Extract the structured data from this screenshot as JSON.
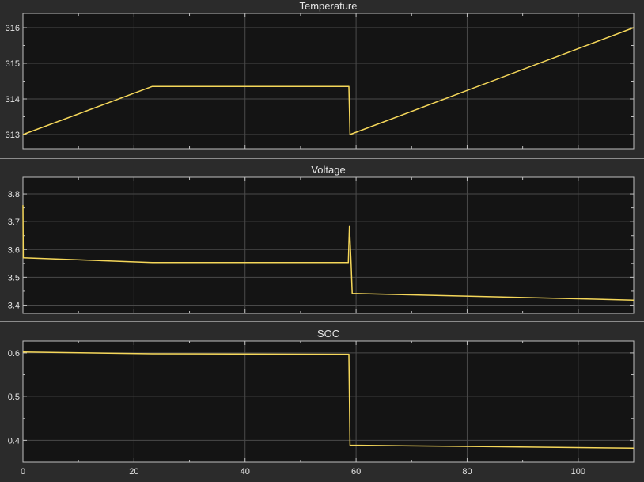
{
  "colors": {
    "background": "#2b2b2b",
    "plot_background": "#141414",
    "grid": "#4a4a4a",
    "axis": "#bfbfbf",
    "text": "#e6e6e6",
    "trace": "#f5d75a"
  },
  "chart_data": [
    {
      "type": "line",
      "title": "Temperature",
      "xlim": [
        0,
        110
      ],
      "ylim": [
        312.6,
        316.4
      ],
      "xticks": [
        0,
        20,
        40,
        60,
        80,
        100
      ],
      "yticks": [
        313,
        314,
        315,
        316
      ],
      "grid": true,
      "show_xtick_labels": false,
      "series": [
        {
          "x": [
            0,
            23.3,
            58.7,
            58.9,
            110
          ],
          "y": [
            313.0,
            314.35,
            314.35,
            313.0,
            316.0
          ]
        }
      ]
    },
    {
      "type": "line",
      "title": "Voltage",
      "xlim": [
        0,
        110
      ],
      "ylim": [
        3.37,
        3.86
      ],
      "xticks": [
        0,
        20,
        40,
        60,
        80,
        100
      ],
      "yticks": [
        3.4,
        3.5,
        3.6,
        3.7,
        3.8
      ],
      "grid": true,
      "show_xtick_labels": false,
      "series": [
        {
          "x": [
            0,
            0.05,
            23.3,
            58.6,
            58.8,
            59.1,
            59.3,
            110
          ],
          "y": [
            3.76,
            3.57,
            3.553,
            3.553,
            3.685,
            3.55,
            3.442,
            3.418
          ]
        }
      ]
    },
    {
      "type": "line",
      "title": "SOC",
      "xlim": [
        0,
        110
      ],
      "ylim": [
        0.35,
        0.627
      ],
      "xticks": [
        0,
        20,
        40,
        60,
        80,
        100
      ],
      "yticks": [
        0.4,
        0.5,
        0.6
      ],
      "grid": true,
      "show_xtick_labels": true,
      "series": [
        {
          "x": [
            0,
            23.3,
            58.7,
            58.9,
            110
          ],
          "y": [
            0.602,
            0.598,
            0.597,
            0.389,
            0.382
          ]
        }
      ]
    }
  ]
}
